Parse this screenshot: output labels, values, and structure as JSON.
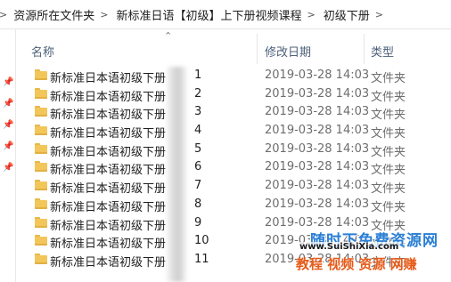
{
  "breadcrumb": {
    "items": [
      "资源所在文件夹",
      "新标准日语【初级】上下册视频课程",
      "初级下册"
    ],
    "separator": ">"
  },
  "columns": {
    "name": "名称",
    "date": "修改日期",
    "type": "类型",
    "sort_icon": "chevron-up-icon"
  },
  "rows": [
    {
      "name": "新标准日本语初级下册",
      "num": "1",
      "date": "2019-03-28 14:03",
      "type": "文件夹"
    },
    {
      "name": "新标准日本语初级下册",
      "num": "2",
      "date": "2019-03-28 14:03",
      "type": "文件夹"
    },
    {
      "name": "新标准日本语初级下册",
      "num": "3",
      "date": "2019-03-28 14:03",
      "type": "文件夹"
    },
    {
      "name": "新标准日本语初级下册",
      "num": "4",
      "date": "2019-03-28 14:03",
      "type": "文件夹"
    },
    {
      "name": "新标准日本语初级下册",
      "num": "5",
      "date": "2019-03-28 14:03",
      "type": "文件夹"
    },
    {
      "name": "新标准日本语初级下册",
      "num": "6",
      "date": "2019-03-28 14:03",
      "type": "文件夹"
    },
    {
      "name": "新标准日本语初级下册",
      "num": "7",
      "date": "2019-03-28 14:03",
      "type": "文件夹"
    },
    {
      "name": "新标准日本语初级下册",
      "num": "8",
      "date": "2019-03-28 14:03",
      "type": "文件夹"
    },
    {
      "name": "新标准日本语初级下册",
      "num": "9",
      "date": "2019-03-28 14:03",
      "type": "文件夹"
    },
    {
      "name": "新标准日本语初级下册",
      "num": "10",
      "date": "2019-03-28 14:03",
      "type": "文件夹"
    },
    {
      "name": "新标准日本语初级下册",
      "num": "11",
      "date": "2019-03-28 14:03",
      "type": "文件夹"
    }
  ],
  "watermark": {
    "line1": "随时下免费资源网",
    "line2": "www.SuiShiXia.com",
    "line3": "教程 视频 资源 网赚"
  },
  "colors": {
    "folder": "#f3c65a",
    "header_text": "#4c607a",
    "meta_text": "#6d6d6d"
  }
}
